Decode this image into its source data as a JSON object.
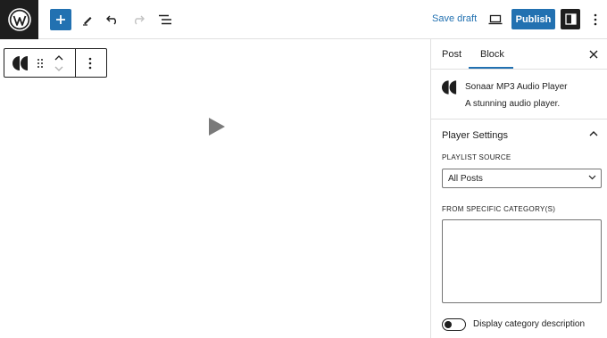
{
  "topbar": {
    "save_draft_label": "Save draft",
    "publish_label": "Publish",
    "icons": [
      "wordpress-icon",
      "plus-icon",
      "pencil-icon",
      "undo-icon",
      "redo-icon",
      "list-view-icon",
      "desktop-icon",
      "settings-panel-icon",
      "more-vertical-icon"
    ]
  },
  "block_toolbar": {
    "icons": [
      "sonaar-icon",
      "drag-handle-icon",
      "move-up-icon",
      "move-down-icon",
      "more-vertical-icon"
    ]
  },
  "sidebar": {
    "tabs": [
      {
        "label": "Post",
        "active": false
      },
      {
        "label": "Block",
        "active": true
      }
    ],
    "block_card": {
      "title": "Sonaar MP3 Audio Player",
      "description": "A stunning audio player."
    },
    "panel": {
      "title": "Player Settings",
      "expanded": true
    },
    "playlist_source": {
      "label": "PLAYLIST SOURCE",
      "value": "All Posts"
    },
    "category": {
      "label": "FROM SPECIFIC CATEGORY(S)",
      "value": ""
    },
    "toggle": {
      "label": "Display category description",
      "checked": false
    }
  },
  "colors": {
    "accent": "#2271b1",
    "dark": "#1e1e1e",
    "play_icon": "#7a7a7a"
  }
}
